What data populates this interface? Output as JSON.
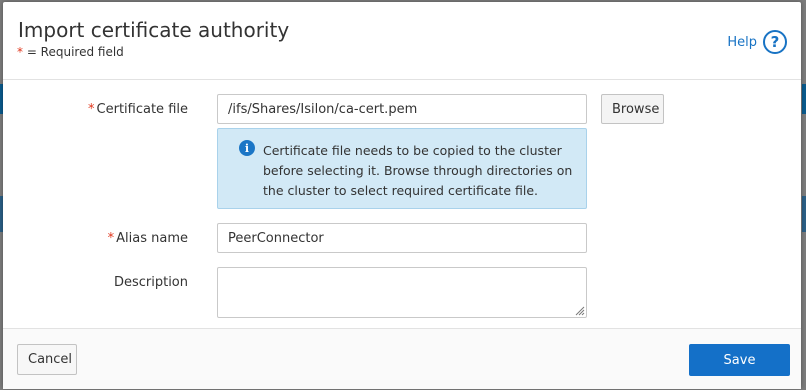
{
  "dialog": {
    "title": "Import certificate authority",
    "required_star": "*",
    "required_note": " = Required field",
    "help_label": "Help",
    "help_icon": "question-circle-icon"
  },
  "form": {
    "certificate_file": {
      "star": "*",
      "label": "Certificate file",
      "value": "/ifs/Shares/Isilon/ca-cert.pem",
      "browse_label": "Browse"
    },
    "info_message": "Certificate file needs to be copied to the cluster before selecting it. Browse through directories on the cluster to select required certificate file.",
    "info_icon": "info-icon",
    "alias_name": {
      "star": "*",
      "label": "Alias name",
      "value": "PeerConnector"
    },
    "description": {
      "label": "Description",
      "value": ""
    }
  },
  "footer": {
    "cancel_label": "Cancel",
    "save_label": "Save"
  },
  "colors": {
    "primary": "#1470c8",
    "required": "#e0351b",
    "info_bg": "#d2e9f6"
  }
}
